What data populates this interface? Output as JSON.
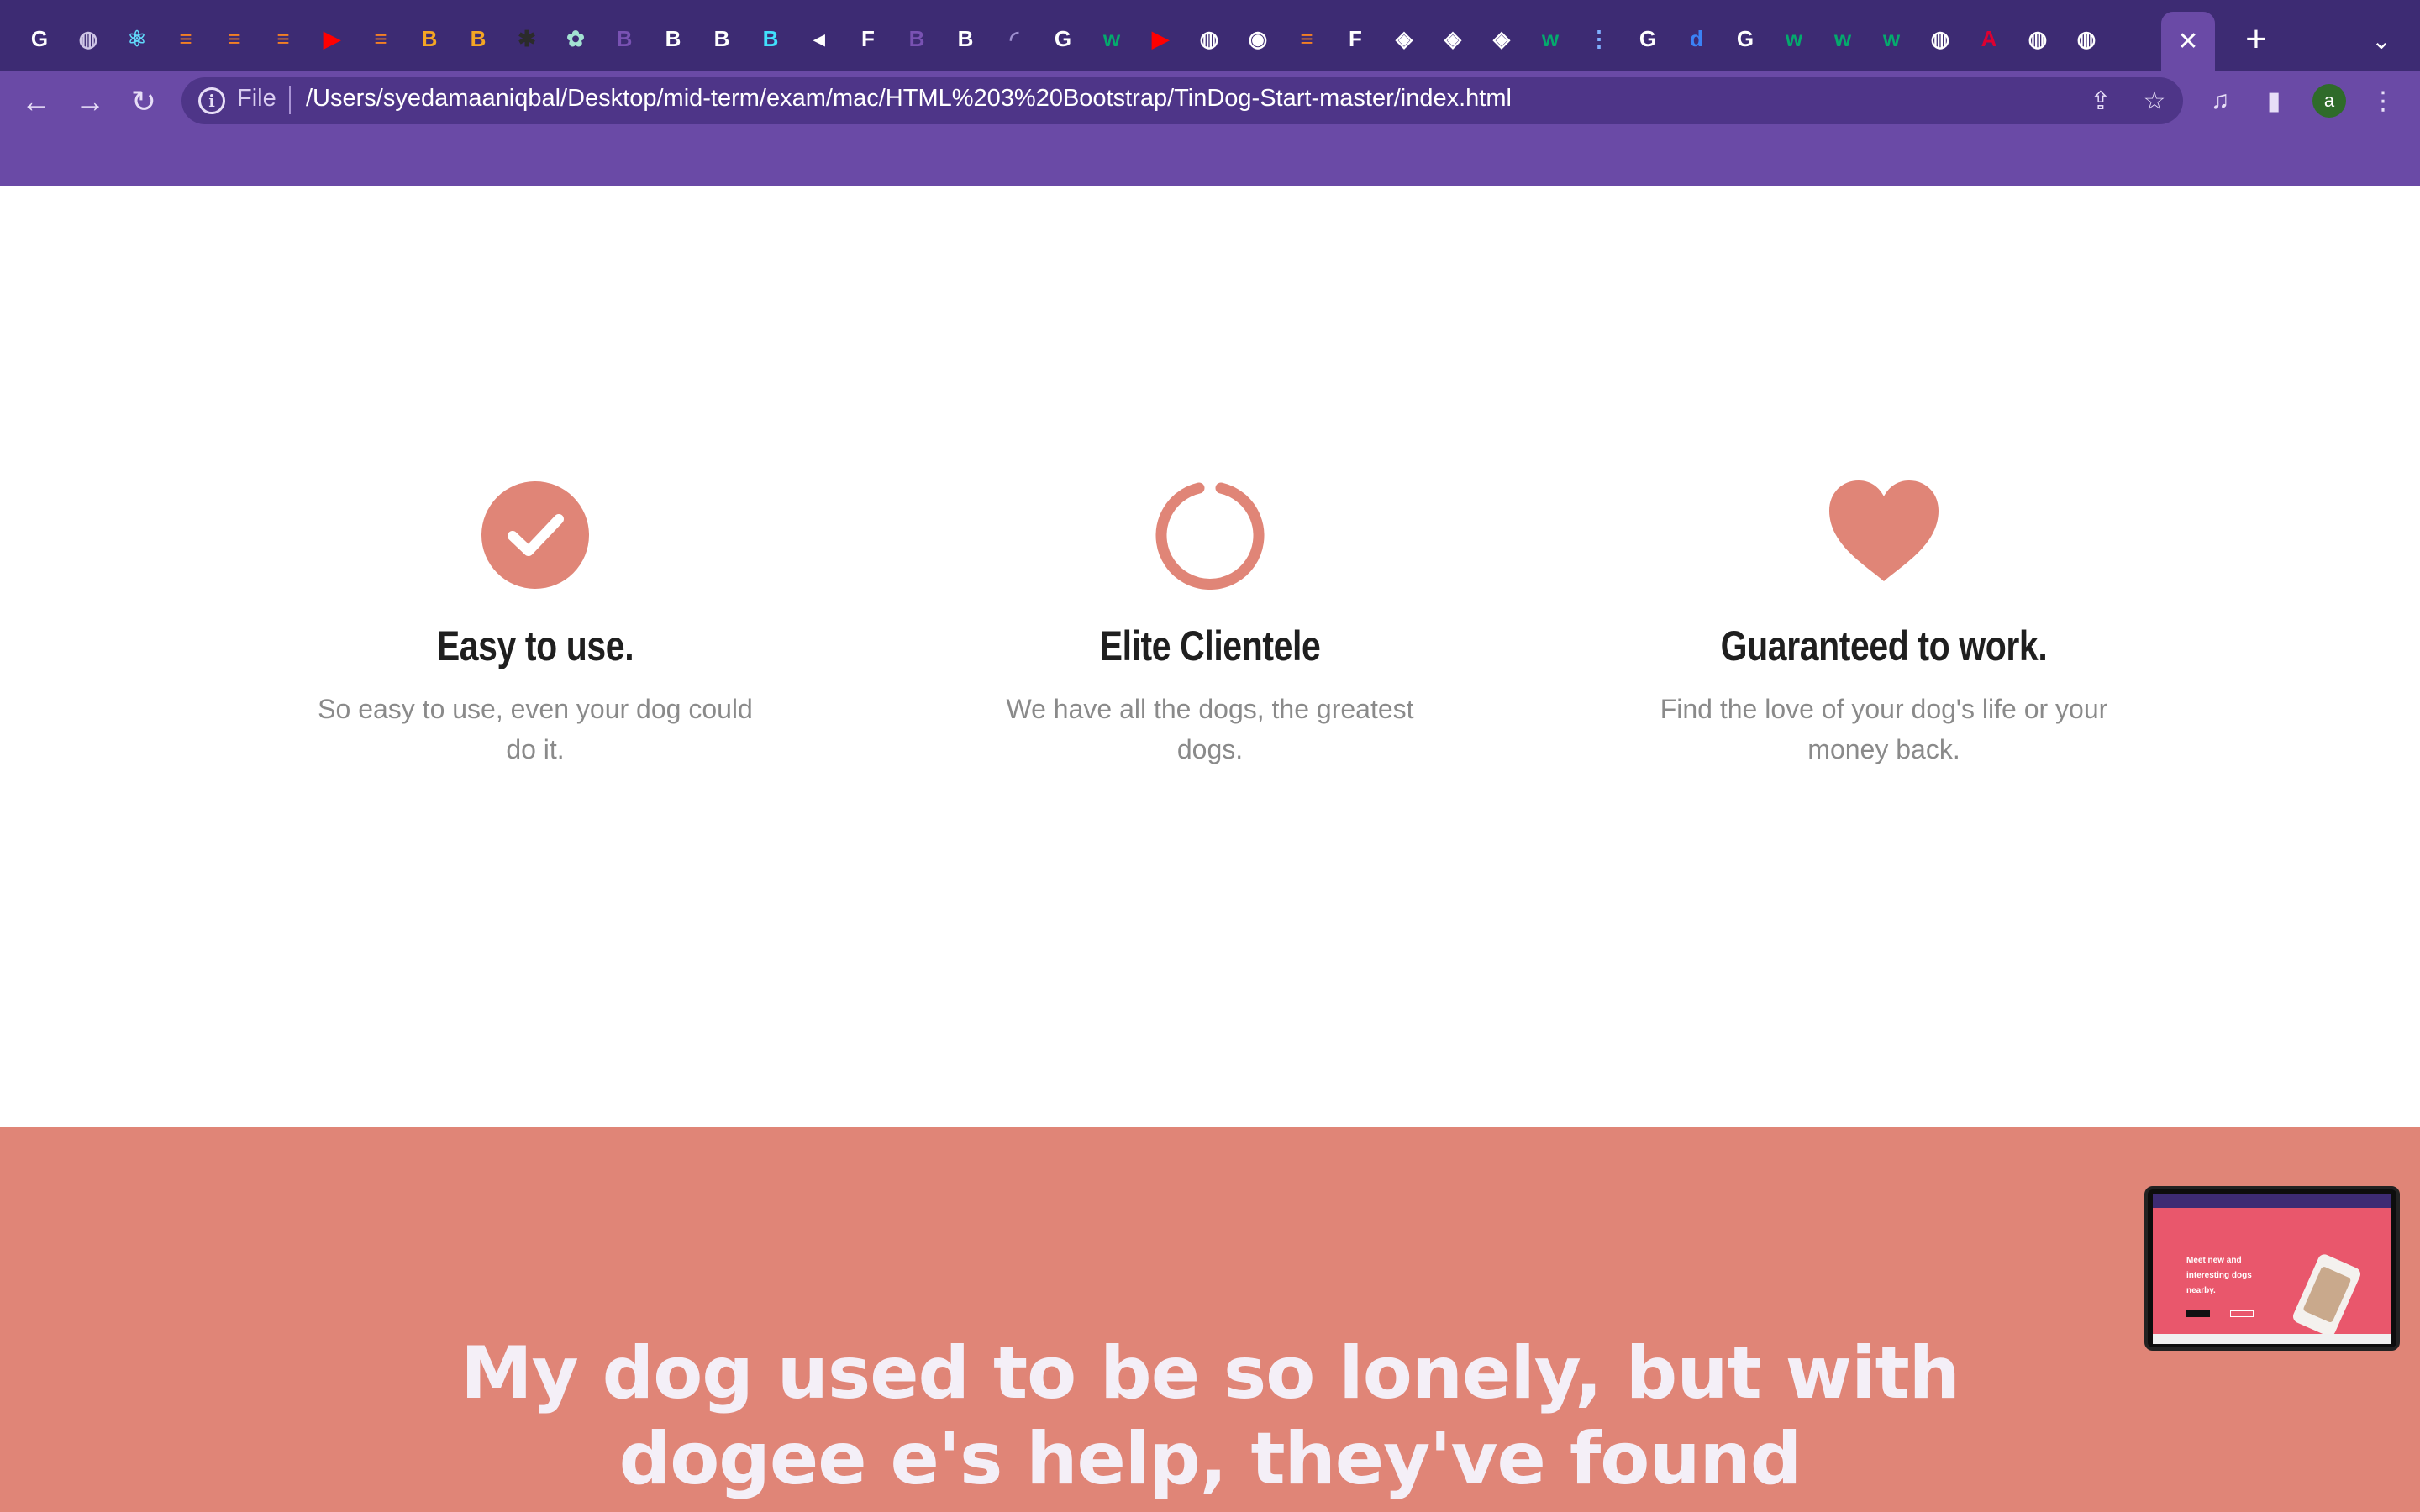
{
  "browser": {
    "tab_icons": [
      {
        "name": "google-icon",
        "glyph": "G",
        "color": "#ffffff"
      },
      {
        "name": "globe-icon",
        "glyph": "◍",
        "color": "#cfc6e6"
      },
      {
        "name": "react-icon",
        "glyph": "⚛",
        "color": "#61dafb"
      },
      {
        "name": "stackoverflow-icon",
        "glyph": "≡",
        "color": "#f48024"
      },
      {
        "name": "stackoverflow-icon",
        "glyph": "≡",
        "color": "#f48024"
      },
      {
        "name": "stackoverflow-icon",
        "glyph": "≡",
        "color": "#f48024"
      },
      {
        "name": "youtube-icon",
        "glyph": "▶",
        "color": "#ff0000"
      },
      {
        "name": "stackoverflow-icon",
        "glyph": "≡",
        "color": "#f48024"
      },
      {
        "name": "colorful-b-icon",
        "glyph": "B",
        "color": "#f5a623"
      },
      {
        "name": "colorful-b-icon",
        "glyph": "B",
        "color": "#f5a623"
      },
      {
        "name": "dark-icon",
        "glyph": "✱",
        "color": "#2b2b2b"
      },
      {
        "name": "chatgpt-icon",
        "glyph": "✿",
        "color": "#a3e2d2"
      },
      {
        "name": "bootstrap-icon",
        "glyph": "B",
        "color": "#7952b3"
      },
      {
        "name": "bold-b-icon",
        "glyph": "B",
        "color": "#ffffff"
      },
      {
        "name": "bold-b-icon",
        "glyph": "B",
        "color": "#ffffff"
      },
      {
        "name": "react-bootstrap-icon",
        "glyph": "B",
        "color": "#41e0fd"
      },
      {
        "name": "speaker-icon",
        "glyph": "◂",
        "color": "#ffffff"
      },
      {
        "name": "framer-f-icon",
        "glyph": "F",
        "color": "#ffffff"
      },
      {
        "name": "bootstrap-icon",
        "glyph": "B",
        "color": "#7952b3"
      },
      {
        "name": "bold-b-icon",
        "glyph": "B",
        "color": "#ffffff"
      },
      {
        "name": "loading-icon",
        "glyph": "◜",
        "color": "#9e8fd0"
      },
      {
        "name": "google-icon",
        "glyph": "G",
        "color": "#ffffff"
      },
      {
        "name": "w3schools-icon",
        "glyph": "w",
        "color": "#04aa6d"
      },
      {
        "name": "youtube-icon",
        "glyph": "▶",
        "color": "#ff0000"
      },
      {
        "name": "globe-icon",
        "glyph": "◍",
        "color": "#ffffff"
      },
      {
        "name": "chrome-icon",
        "glyph": "◉",
        "color": "#ffffff"
      },
      {
        "name": "stackoverflow-icon",
        "glyph": "≡",
        "color": "#f48024"
      },
      {
        "name": "framer-f-icon",
        "glyph": "F",
        "color": "#ffffff"
      },
      {
        "name": "codepen-icon",
        "glyph": "◈",
        "color": "#ffffff"
      },
      {
        "name": "codepen-icon",
        "glyph": "◈",
        "color": "#ffffff"
      },
      {
        "name": "codepen-icon",
        "glyph": "◈",
        "color": "#ffffff"
      },
      {
        "name": "w3schools-icon",
        "glyph": "w",
        "color": "#04aa6d"
      },
      {
        "name": "dots-icon",
        "glyph": "⋮",
        "color": "#7fb0ff"
      },
      {
        "name": "google-icon",
        "glyph": "G",
        "color": "#ffffff"
      },
      {
        "name": "d-icon",
        "glyph": "d",
        "color": "#3b82f6"
      },
      {
        "name": "google-icon",
        "glyph": "G",
        "color": "#ffffff"
      },
      {
        "name": "w3schools-icon",
        "glyph": "w",
        "color": "#04aa6d"
      },
      {
        "name": "w3schools-icon",
        "glyph": "w",
        "color": "#04aa6d"
      },
      {
        "name": "w3schools-icon",
        "glyph": "w",
        "color": "#04aa6d"
      },
      {
        "name": "globe-icon",
        "glyph": "◍",
        "color": "#ffffff"
      },
      {
        "name": "angular-icon",
        "glyph": "A",
        "color": "#dd0031"
      },
      {
        "name": "globe-icon",
        "glyph": "◍",
        "color": "#ffffff"
      },
      {
        "name": "globe-icon",
        "glyph": "◍",
        "color": "#ffffff"
      }
    ],
    "active_tab_close": "✕",
    "new_tab": "+",
    "tab_search": "⌄",
    "back": "←",
    "forward": "→",
    "reload": "↻",
    "info_glyph": "i",
    "scheme_label": "File",
    "url": "/Users/syedamaaniqbal/Desktop/mid-term/exam/mac/HTML%203%20Bootstrap/TinDog-Start-master/index.html",
    "share": "⇪",
    "bookmark": "☆",
    "media": "♫",
    "side_panel": "▮",
    "profile_initial": "a",
    "menu": "⋮"
  },
  "features": [
    {
      "icon": "check-circle-icon",
      "title": "Easy to use.",
      "text": "So easy to use, even your dog could do it."
    },
    {
      "icon": "loading-circle-icon",
      "title": "Elite Clientele",
      "text": "We have all the dogs, the greatest dogs."
    },
    {
      "icon": "heart-icon",
      "title": "Guaranteed to work.",
      "text": "Find the love of your dog's life or your money back."
    }
  ],
  "testimonial": {
    "text": "My dog used to be so lonely, but with dogee e's help, they've found"
  },
  "thumbnail": {
    "headline": "Meet new and interesting dogs nearby."
  },
  "colors": {
    "accent": "#e08577",
    "tabstrip": "#3d2b73",
    "toolbar": "#6a4aa6"
  }
}
